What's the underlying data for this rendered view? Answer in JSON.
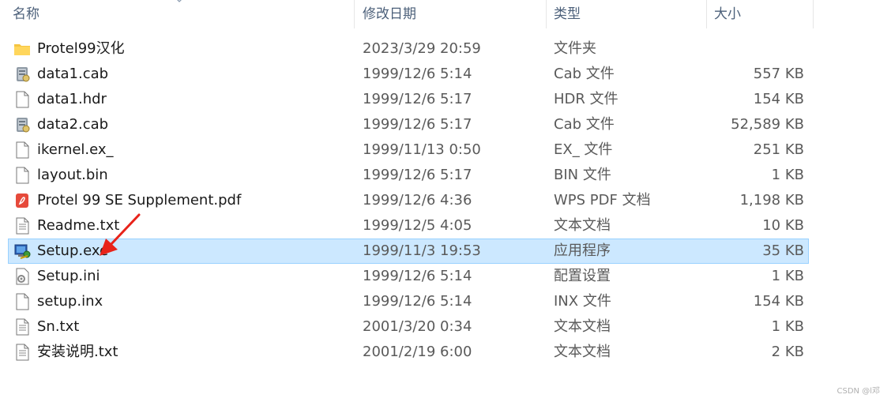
{
  "columns": {
    "name": "名称",
    "date": "修改日期",
    "type": "类型",
    "size": "大小"
  },
  "files": [
    {
      "name": "Protel99汉化",
      "date": "2023/3/29 20:59",
      "type": "文件夹",
      "size": "",
      "icon": "folder-icon"
    },
    {
      "name": "data1.cab",
      "date": "1999/12/6 5:14",
      "type": "Cab 文件",
      "size": "557 KB",
      "icon": "cab-file-icon"
    },
    {
      "name": "data1.hdr",
      "date": "1999/12/6 5:17",
      "type": "HDR 文件",
      "size": "154 KB",
      "icon": "generic-file-icon"
    },
    {
      "name": "data2.cab",
      "date": "1999/12/6 5:17",
      "type": "Cab 文件",
      "size": "52,589 KB",
      "icon": "cab-file-icon"
    },
    {
      "name": "ikernel.ex_",
      "date": "1999/11/13 0:50",
      "type": "EX_ 文件",
      "size": "251 KB",
      "icon": "generic-file-icon"
    },
    {
      "name": "layout.bin",
      "date": "1999/12/6 5:17",
      "type": "BIN 文件",
      "size": "1 KB",
      "icon": "generic-file-icon"
    },
    {
      "name": "Protel 99 SE Supplement.pdf",
      "date": "1999/12/6 4:36",
      "type": "WPS PDF 文档",
      "size": "1,198 KB",
      "icon": "pdf-file-icon"
    },
    {
      "name": "Readme.txt",
      "date": "1999/12/5 4:05",
      "type": "文本文档",
      "size": "10 KB",
      "icon": "text-file-icon"
    },
    {
      "name": "Setup.exe",
      "date": "1999/11/3 19:53",
      "type": "应用程序",
      "size": "35 KB",
      "icon": "setup-exe-icon",
      "selected": true
    },
    {
      "name": "Setup.ini",
      "date": "1999/12/6 5:14",
      "type": "配置设置",
      "size": "1 KB",
      "icon": "config-file-icon"
    },
    {
      "name": "setup.inx",
      "date": "1999/12/6 5:14",
      "type": "INX 文件",
      "size": "154 KB",
      "icon": "generic-file-icon"
    },
    {
      "name": "Sn.txt",
      "date": "2001/3/20 0:34",
      "type": "文本文档",
      "size": "1 KB",
      "icon": "text-file-icon"
    },
    {
      "name": "安装说明.txt",
      "date": "2001/2/19 6:00",
      "type": "文本文档",
      "size": "2 KB",
      "icon": "text-file-icon"
    }
  ],
  "watermark": "CSDN @l邓",
  "colors": {
    "selection_bg": "#cce8ff",
    "selection_border": "#99d1ff",
    "header_text": "#4c607a",
    "annotation_arrow": "#e8231a"
  }
}
